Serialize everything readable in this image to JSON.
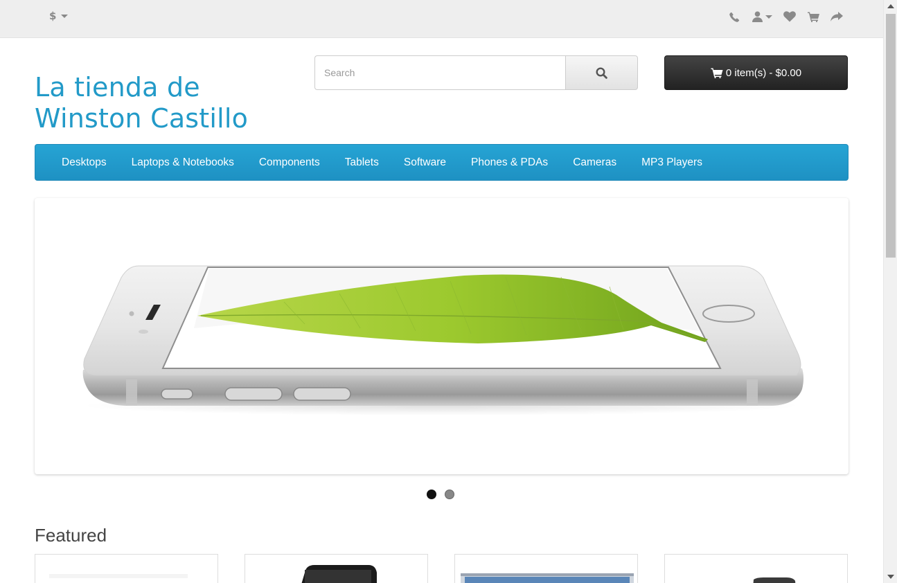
{
  "topbar": {
    "currency_symbol": "$",
    "icons": [
      "phone-icon",
      "user-icon",
      "heart-icon",
      "shopping-cart-icon",
      "share-icon"
    ]
  },
  "header": {
    "store_name": "La tienda de Winston Castillo"
  },
  "search": {
    "placeholder": "Search"
  },
  "cart": {
    "label": "0 item(s) - $0.00"
  },
  "menu": {
    "items": [
      "Desktops",
      "Laptops & Notebooks",
      "Components",
      "Tablets",
      "Software",
      "Phones & PDAs",
      "Cameras",
      "MP3 Players"
    ]
  },
  "slideshow": {
    "slide_count": 2,
    "active_slide": 1
  },
  "featured": {
    "title": "Featured"
  },
  "colors": {
    "brand": "#229ac8",
    "menu_bg": "#229ac8",
    "cart_bg": "#303030",
    "topbar_bg": "#eeeeee"
  }
}
